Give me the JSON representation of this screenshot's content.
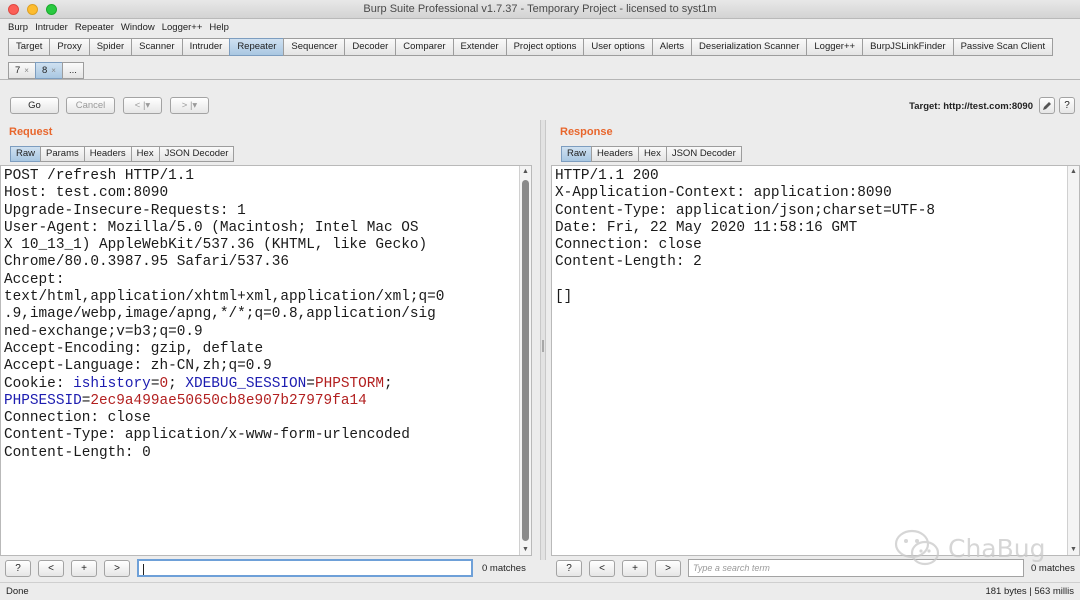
{
  "window": {
    "title": "Burp Suite Professional v1.7.37 - Temporary Project - licensed to syst1m"
  },
  "menu": [
    "Burp",
    "Intruder",
    "Repeater",
    "Window",
    "Logger++",
    "Help"
  ],
  "main_tabs": [
    "Target",
    "Proxy",
    "Spider",
    "Scanner",
    "Intruder",
    "Repeater",
    "Sequencer",
    "Decoder",
    "Comparer",
    "Extender",
    "Project options",
    "User options",
    "Alerts",
    "Deserialization Scanner",
    "Logger++",
    "BurpJSLinkFinder",
    "Passive Scan Client"
  ],
  "main_tabs_active": "Repeater",
  "sub_tabs": [
    {
      "label": "7",
      "close": "×"
    },
    {
      "label": "8",
      "close": "×"
    },
    {
      "label": "..."
    }
  ],
  "toolbar": {
    "go_label": "Go",
    "cancel_label": "Cancel",
    "back_label": "< |▾",
    "forward_label": "> |▾",
    "target_label": "Target: http://test.com:8090",
    "edit_icon": "pencil-icon",
    "help_icon": "question-icon",
    "help_label": "?"
  },
  "request": {
    "title": "Request",
    "tabs": [
      "Raw",
      "Params",
      "Headers",
      "Hex",
      "JSON Decoder"
    ],
    "active_tab": "Raw",
    "lines": [
      "POST /refresh HTTP/1.1",
      "Host: test.com:8090",
      "Upgrade-Insecure-Requests: 1",
      "User-Agent: Mozilla/5.0 (Macintosh; Intel Mac OS",
      "X 10_13_1) AppleWebKit/537.36 (KHTML, like Gecko)",
      "Chrome/80.0.3987.95 Safari/537.36",
      "Accept:",
      "text/html,application/xhtml+xml,application/xml;q=0",
      ".9,image/webp,image/apng,*/*;q=0.8,application/sig",
      "ned-exchange;v=b3;q=0.9",
      "Accept-Encoding: gzip, deflate",
      "Accept-Language: zh-CN,zh;q=0.9"
    ],
    "cookie": {
      "prefix": "Cookie: ",
      "n1": "ishistory",
      "eq": "=",
      "v1": "0",
      "sep": "; ",
      "n2": "XDEBUG_SESSION",
      "v2": "PHPSTORM",
      "semi": ";",
      "n3": "PHPSESSID",
      "v3": "2ec9a499ae50650cb8e907b27979fa14"
    },
    "lines_after": [
      "Connection: close",
      "Content-Type: application/x-www-form-urlencoded",
      "Content-Length: 0"
    ],
    "search": {
      "help": "?",
      "prev": "<",
      "add": "+",
      "next": ">",
      "value": "",
      "matches": "0 matches"
    }
  },
  "response": {
    "title": "Response",
    "tabs": [
      "Raw",
      "Headers",
      "Hex",
      "JSON Decoder"
    ],
    "active_tab": "Raw",
    "lines": [
      "HTTP/1.1 200",
      "X-Application-Context: application:8090",
      "Content-Type: application/json;charset=UTF-8",
      "Date: Fri, 22 May 2020 11:58:16 GMT",
      "Connection: close",
      "Content-Length: 2",
      "",
      "[]"
    ],
    "search": {
      "help": "?",
      "prev": "<",
      "add": "+",
      "next": ">",
      "placeholder": "Type a search term",
      "matches": "0 matches"
    }
  },
  "status": {
    "left": "Done",
    "right": "181 bytes | 563 millis"
  },
  "watermark": {
    "text": "ChaBug",
    "icon": "wechat-icon"
  }
}
